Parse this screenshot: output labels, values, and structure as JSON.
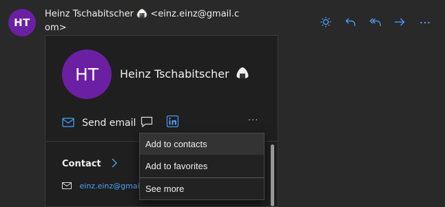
{
  "sender": {
    "initials": "HT",
    "display": "Heinz Tschabitscher 🍙 <einz.einz@gmail.com>"
  },
  "toolbar": {
    "icons": [
      "sun-icon",
      "reply-icon",
      "reply-all-icon",
      "forward-icon",
      "more-icon"
    ]
  },
  "card": {
    "initials": "HT",
    "name": "Heinz Tschabitscher",
    "send_email_label": "Send email",
    "more_label": "···",
    "contact_label": "Contact",
    "email": "einz.einz@gmail.com"
  },
  "menu": {
    "items": [
      "Add to contacts",
      "Add to favorites",
      "See more"
    ]
  },
  "colors": {
    "accent": "#4ea1ff",
    "avatar": "#6b1fa3",
    "background": "#292929"
  }
}
